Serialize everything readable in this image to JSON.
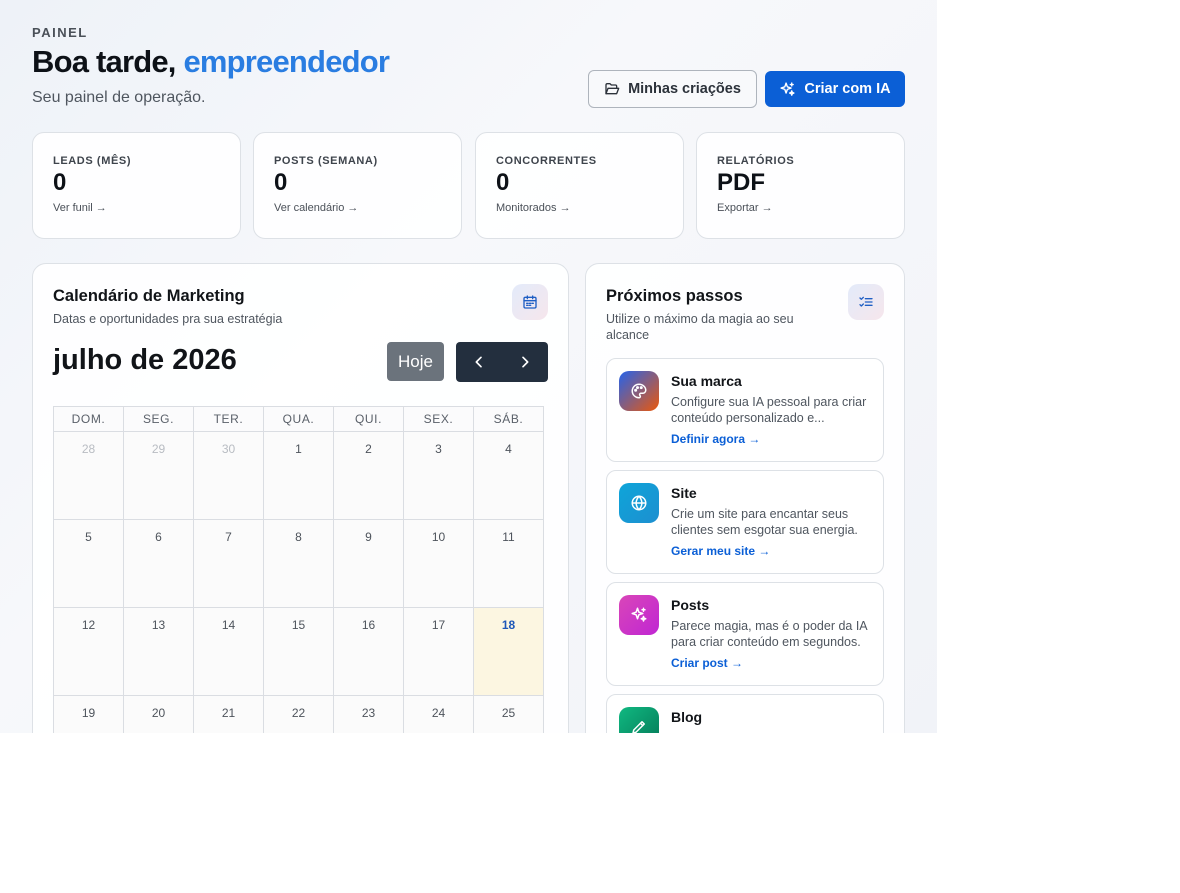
{
  "header": {
    "overline": "PAINEL",
    "greeting": "Boa tarde,",
    "name": "empreendedor",
    "subtitle": "Seu painel de operação.",
    "my_creations_label": "Minhas criações",
    "create_ai_label": "Criar com IA"
  },
  "stats": [
    {
      "label": "LEADS (MÊS)",
      "value": "0",
      "link": "Ver funil →"
    },
    {
      "label": "POSTS (SEMANA)",
      "value": "0",
      "link": "Ver calendário →"
    },
    {
      "label": "CONCORRENTES",
      "value": "0",
      "link": "Monitorados →"
    },
    {
      "label": "RELATÓRIOS",
      "value": "PDF",
      "link": "Exportar →"
    }
  ],
  "calendar": {
    "title": "Calendário de Marketing",
    "subtitle": "Datas e oportunidades pra sua estratégia",
    "month_label": "julho de 2026",
    "today_label": "Hoje",
    "weekdays": [
      "DOM.",
      "SEG.",
      "TER.",
      "QUA.",
      "QUI.",
      "SEX.",
      "SÁB."
    ],
    "weeks": [
      [
        "28",
        "29",
        "30",
        "1",
        "2",
        "3",
        "4"
      ],
      [
        "5",
        "6",
        "7",
        "8",
        "9",
        "10",
        "11"
      ],
      [
        "12",
        "13",
        "14",
        "15",
        "16",
        "17",
        "18"
      ],
      [
        "19",
        "20",
        "21",
        "22",
        "23",
        "24",
        "25"
      ]
    ],
    "today": "18"
  },
  "next_steps": {
    "title": "Próximos passos",
    "subtitle": "Utilize o máximo da magia ao seu alcance",
    "items": [
      {
        "title": "Sua marca",
        "description": "Configure sua IA pessoal para criar conteúdo personalizado e...",
        "link": "Definir agora →",
        "icon": "palette-icon",
        "color": "#c2410c"
      },
      {
        "title": "Site",
        "description": "Crie um site para encantar seus clientes sem esgotar sua energia.",
        "link": "Gerar meu site →",
        "icon": "globe-icon",
        "color": "#0ea5d9"
      },
      {
        "title": "Posts",
        "description": "Parece magia, mas é o poder da IA para criar conteúdo em segundos.",
        "link": "Criar post →",
        "icon": "sparkles-icon",
        "color": "#d946b8"
      },
      {
        "title": "Blog",
        "description": "",
        "link": "",
        "icon": "pencil-icon",
        "color": "#059669"
      }
    ]
  }
}
